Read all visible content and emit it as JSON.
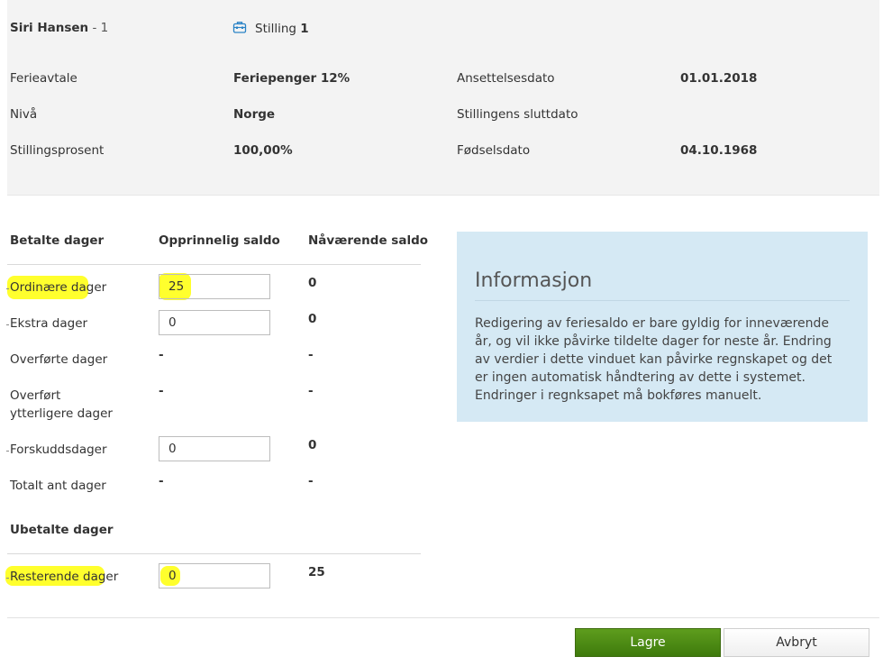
{
  "employee": {
    "name": "Siri Hansen",
    "suffix": " - 1",
    "position_label": "Stilling",
    "position_number": "1"
  },
  "details": {
    "left": [
      {
        "label": "Ferieavtale",
        "value": "Feriepenger 12%"
      },
      {
        "label": "Nivå",
        "value": "Norge"
      },
      {
        "label": "Stillingsprosent",
        "value": "100,00%"
      }
    ],
    "right": [
      {
        "label": "Ansettelsesdato",
        "value": "01.01.2018"
      },
      {
        "label": "Stillingens sluttdato",
        "value": ""
      },
      {
        "label": "Fødselsdato",
        "value": "04.10.1968"
      }
    ]
  },
  "table": {
    "headers": [
      "Betalte dager",
      "Opprinnelig saldo",
      "Nåværende saldo"
    ],
    "rows": [
      {
        "label": "Ordinære dager",
        "input": "25",
        "current": "0"
      },
      {
        "label": "Ekstra dager",
        "input": "0",
        "current": "0"
      },
      {
        "label": "Overførte dager",
        "original": "-",
        "current": "-"
      },
      {
        "label_line1": "Overført",
        "label_line2": "ytterligere dager",
        "original": "-",
        "current": "-"
      },
      {
        "label": "Forskuddsdager",
        "input": "0",
        "current": "0"
      },
      {
        "label": "Totalt ant dager",
        "original": "-",
        "current": "-"
      }
    ],
    "unpaid_header": "Ubetalte dager",
    "unpaid_rows": [
      {
        "label": "Resterende dager",
        "input": "0",
        "current": "25"
      }
    ]
  },
  "info": {
    "title": "Informasjon",
    "text": "Redigering av feriesaldo er bare gyldig for inneværende år, og vil ikke påvirke tildelte dager for neste år. Endring av verdier i dette vinduet kan påvirke regnskapet og det er ingen automatisk håndtering av dette i systemet. Endringer i regnksapet må bokføres manuelt."
  },
  "buttons": {
    "save": "Lagre",
    "cancel": "Avbryt"
  },
  "colors": {
    "header_bg": "#f3f3f3",
    "info_bg": "#d5e9f4",
    "save_green": "#4a8a14",
    "highlight": "#ffff22",
    "icon_blue": "#2a83c6"
  },
  "icons": {
    "position": "briefcase-icon"
  }
}
